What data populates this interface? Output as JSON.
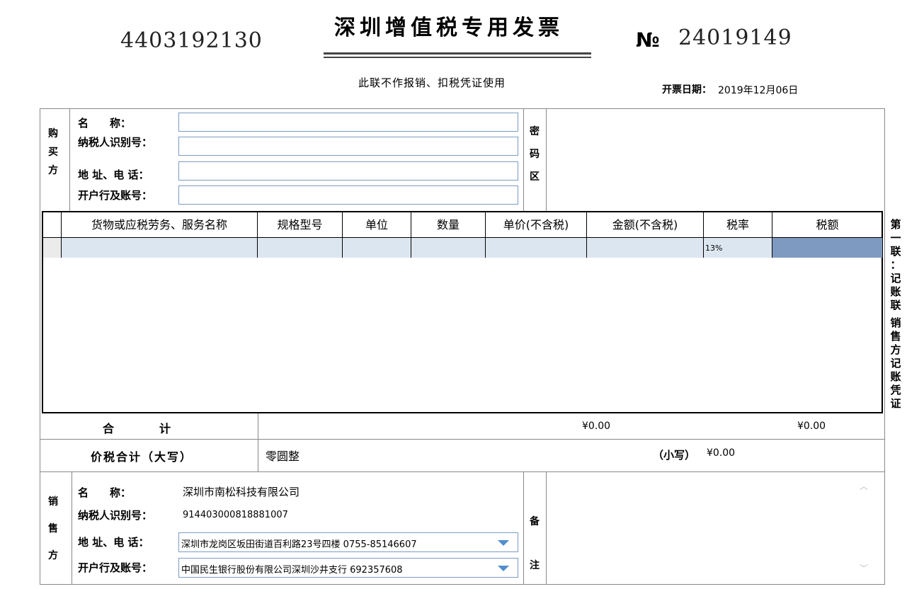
{
  "invoice": {
    "code": "4403192130",
    "title": "深圳增值税专用发票",
    "no_symbol": "№",
    "number": "24019149",
    "subtitle": "此联不作报销、扣税凭证使用",
    "date_label": "开票日期：",
    "date_value": "2019年12月06日"
  },
  "buyer": {
    "side_label": [
      "购",
      "买",
      "方"
    ],
    "name_label": "名　　称：",
    "tax_id_label": "纳税人识别号：",
    "address_label": "地 址、电 话：",
    "bank_label": "开户行及账号：",
    "name_value": "",
    "tax_id_value": "",
    "address_value": "",
    "bank_value": ""
  },
  "cipher": {
    "label": [
      "密",
      "码",
      "区"
    ]
  },
  "items_table": {
    "headers": [
      "货物或应税劳务、服务名称",
      "规格型号",
      "单位",
      "数量",
      "单价(不含税)",
      "金额(不含税)",
      "税率",
      "税额"
    ],
    "rows": [
      {
        "name": "",
        "spec": "",
        "unit": "",
        "qty": "",
        "price": "",
        "amount": "",
        "rate": "13%",
        "tax": ""
      }
    ]
  },
  "totals": {
    "label": "合　　　　计",
    "amount": "¥0.00",
    "tax": "¥0.00",
    "sum_label": "价税合计（大写）",
    "sum_upper": "零圆整",
    "sum_lower_label": "（小写）",
    "sum_lower": "¥0.00"
  },
  "seller": {
    "side_label": [
      "销",
      "售",
      "方"
    ],
    "name_label": "名　　称：",
    "tax_id_label": "纳税人识别号：",
    "address_label": "地 址、电 话：",
    "bank_label": "开户行及账号：",
    "name_value": "深圳市南松科技有限公司",
    "tax_id_value": "914403000818881007",
    "address_value": "深圳市龙岗区坂田街道百利路23号四楼 0755-85146607",
    "bank_value": "中国民生银行股份有限公司深圳沙井支行 692357608"
  },
  "remarks": {
    "label": [
      "备",
      "注"
    ],
    "value": ""
  },
  "side_note": [
    "第",
    "一",
    "联",
    "：",
    "记",
    "账",
    "联",
    " ",
    "销",
    "售",
    "方",
    "记",
    "账",
    "凭",
    "证"
  ],
  "colors": {
    "field_border": "#7a9cc6",
    "row_fill": "#dce6f0",
    "tax_cell": "#7f9ac0",
    "dropdown": "#4f8ecf"
  }
}
